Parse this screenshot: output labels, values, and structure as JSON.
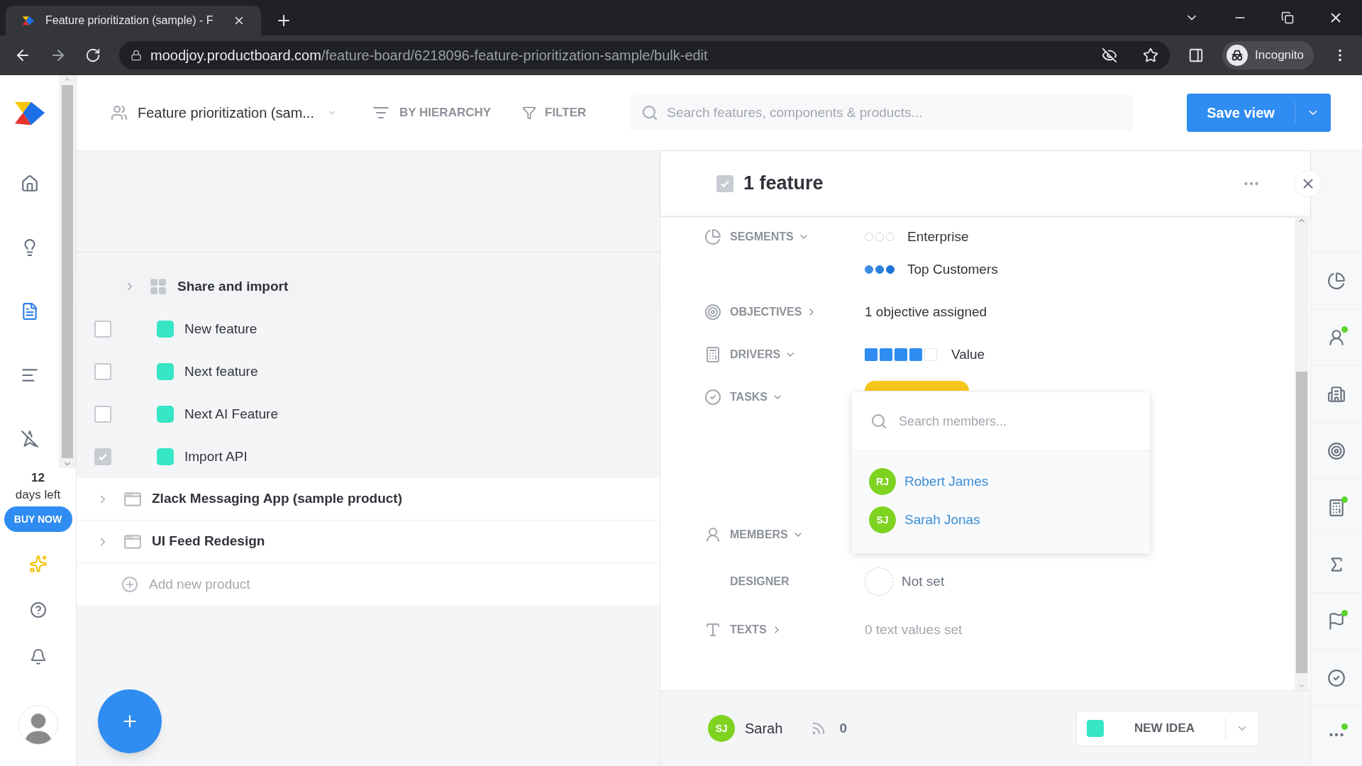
{
  "browser": {
    "tab_title": "Feature prioritization (sample) - F",
    "url_host": "moodjoy.productboard.com",
    "url_path": "/feature-board/6218096-feature-prioritization-sample/bulk-edit",
    "profile": "Incognito"
  },
  "nav": {
    "items": [
      {
        "kind": "home",
        "selected": false
      },
      {
        "kind": "insights",
        "selected": false
      },
      {
        "kind": "features",
        "selected": true
      },
      {
        "kind": "roadmap",
        "selected": false
      },
      {
        "kind": "strategy",
        "selected": false
      }
    ],
    "trial": {
      "days": "12",
      "label": "days left",
      "button": "BUY NOW"
    }
  },
  "toolbar": {
    "board_title": "Feature prioritization (sam...",
    "grouping": "BY HIERARCHY",
    "filter": "FILTER",
    "search": {
      "placeholder": "Search features, components & products..."
    },
    "save": "Save view"
  },
  "tree": [
    {
      "kind": "component",
      "label": "Share and import",
      "children": [
        {
          "kind": "feature",
          "label": "New feature",
          "checked": false
        },
        {
          "kind": "feature",
          "label": "Next feature",
          "checked": false
        },
        {
          "kind": "feature",
          "label": "Next AI Feature",
          "checked": false
        },
        {
          "kind": "feature",
          "label": "Import API",
          "checked": true
        }
      ]
    },
    {
      "kind": "product",
      "label": "Zlack Messaging App (sample product)"
    },
    {
      "kind": "product",
      "label": "UI Feed Redesign"
    }
  ],
  "add_product": "Add new product",
  "detail": {
    "title": "1 feature",
    "checked": true,
    "fields": [
      {
        "kind": "segments",
        "label": "SEGMENTS",
        "expanded": true,
        "items": [
          {
            "name": "Enterprise",
            "stars": 0
          },
          {
            "name": "Top Customers",
            "stars": 3
          }
        ]
      },
      {
        "kind": "objectives",
        "label": "OBJECTIVES",
        "expanded": false,
        "value": "1 objective assigned"
      },
      {
        "kind": "drivers",
        "label": "DRIVERS",
        "expanded": true,
        "items": [
          {
            "name": "Value",
            "stars": 4
          }
        ]
      },
      {
        "kind": "tasks",
        "label": "TASKS",
        "expanded": true
      },
      {
        "kind": "members",
        "label": "MEMBERS",
        "expanded": true
      },
      {
        "kind": "designer",
        "label": "DESIGNER",
        "value": "Not set"
      },
      {
        "kind": "texts",
        "label": "TEXTS",
        "expanded": false,
        "value": "0 text values set"
      }
    ],
    "member_picker": {
      "placeholder": "Search members...",
      "members": [
        {
          "initials": "RJ",
          "name": "Robert James"
        },
        {
          "initials": "SJ",
          "name": "Sarah Jonas"
        }
      ]
    },
    "footer": {
      "initials": "SJ",
      "name": "Sarah",
      "votes": "0",
      "status": "NEW IDEA"
    }
  },
  "rail": [
    {
      "kind": "segments",
      "notify": false
    },
    {
      "kind": "person",
      "notify": true
    },
    {
      "kind": "building",
      "notify": false
    },
    {
      "kind": "target",
      "notify": false
    },
    {
      "kind": "calculator",
      "notify": true
    },
    {
      "kind": "sigma",
      "notify": false
    },
    {
      "kind": "flag",
      "notify": true
    },
    {
      "kind": "check",
      "notify": false
    },
    {
      "kind": "more",
      "notify": true
    }
  ]
}
